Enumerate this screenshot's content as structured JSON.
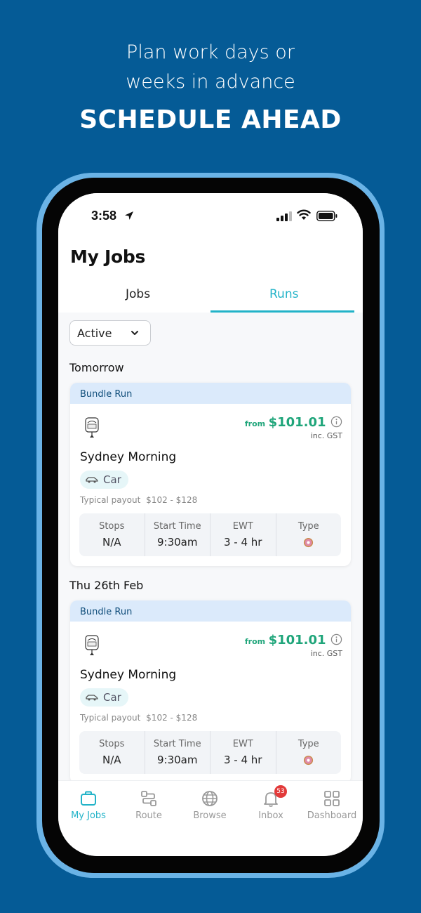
{
  "promo": {
    "subtitle_line1": "Plan work days or",
    "subtitle_line2": "weeks in advance",
    "headline": "SCHEDULE AHEAD"
  },
  "status_bar": {
    "time": "3:58"
  },
  "header": {
    "title": "My Jobs",
    "tabs": [
      {
        "label": "Jobs",
        "active": false
      },
      {
        "label": "Runs",
        "active": true
      }
    ]
  },
  "filter": {
    "selected": "Active"
  },
  "groups": [
    {
      "day": "Tomorrow",
      "card": {
        "type": "Bundle Run",
        "price_prefix": "from",
        "price": "$101.01",
        "tax_note": "inc. GST",
        "name": "Sydney Morning",
        "vehicle": "Car",
        "payout_label": "Typical payout",
        "payout_range": "$102 - $128",
        "stats": [
          {
            "label": "Stops",
            "value": "N/A"
          },
          {
            "label": "Start Time",
            "value": "9:30am"
          },
          {
            "label": "EWT",
            "value": "3 - 4 hr"
          },
          {
            "label": "Type",
            "icon": "donut-icon"
          }
        ]
      }
    },
    {
      "day": "Thu 26th Feb",
      "card": {
        "type": "Bundle Run",
        "price_prefix": "from",
        "price": "$101.01",
        "tax_note": "inc. GST",
        "name": "Sydney Morning",
        "vehicle": "Car",
        "payout_label": "Typical payout",
        "payout_range": "$102 - $128",
        "stats": [
          {
            "label": "Stops",
            "value": "N/A"
          },
          {
            "label": "Start Time",
            "value": "9:30am"
          },
          {
            "label": "EWT",
            "value": "3 - 4 hr"
          },
          {
            "label": "Type",
            "icon": "donut-icon"
          }
        ]
      }
    }
  ],
  "nav": {
    "items": [
      {
        "label": "My Jobs",
        "icon": "briefcase-icon",
        "active": true
      },
      {
        "label": "Route",
        "icon": "route-icon",
        "active": false
      },
      {
        "label": "Browse",
        "icon": "globe-icon",
        "active": false
      },
      {
        "label": "Inbox",
        "icon": "bell-icon",
        "active": false,
        "badge": "53"
      },
      {
        "label": "Dashboard",
        "icon": "grid-icon",
        "active": false
      }
    ]
  },
  "colors": {
    "background": "#055b96",
    "accent": "#22b3c8",
    "price": "#1fa57a",
    "badge": "#e23a3a"
  }
}
